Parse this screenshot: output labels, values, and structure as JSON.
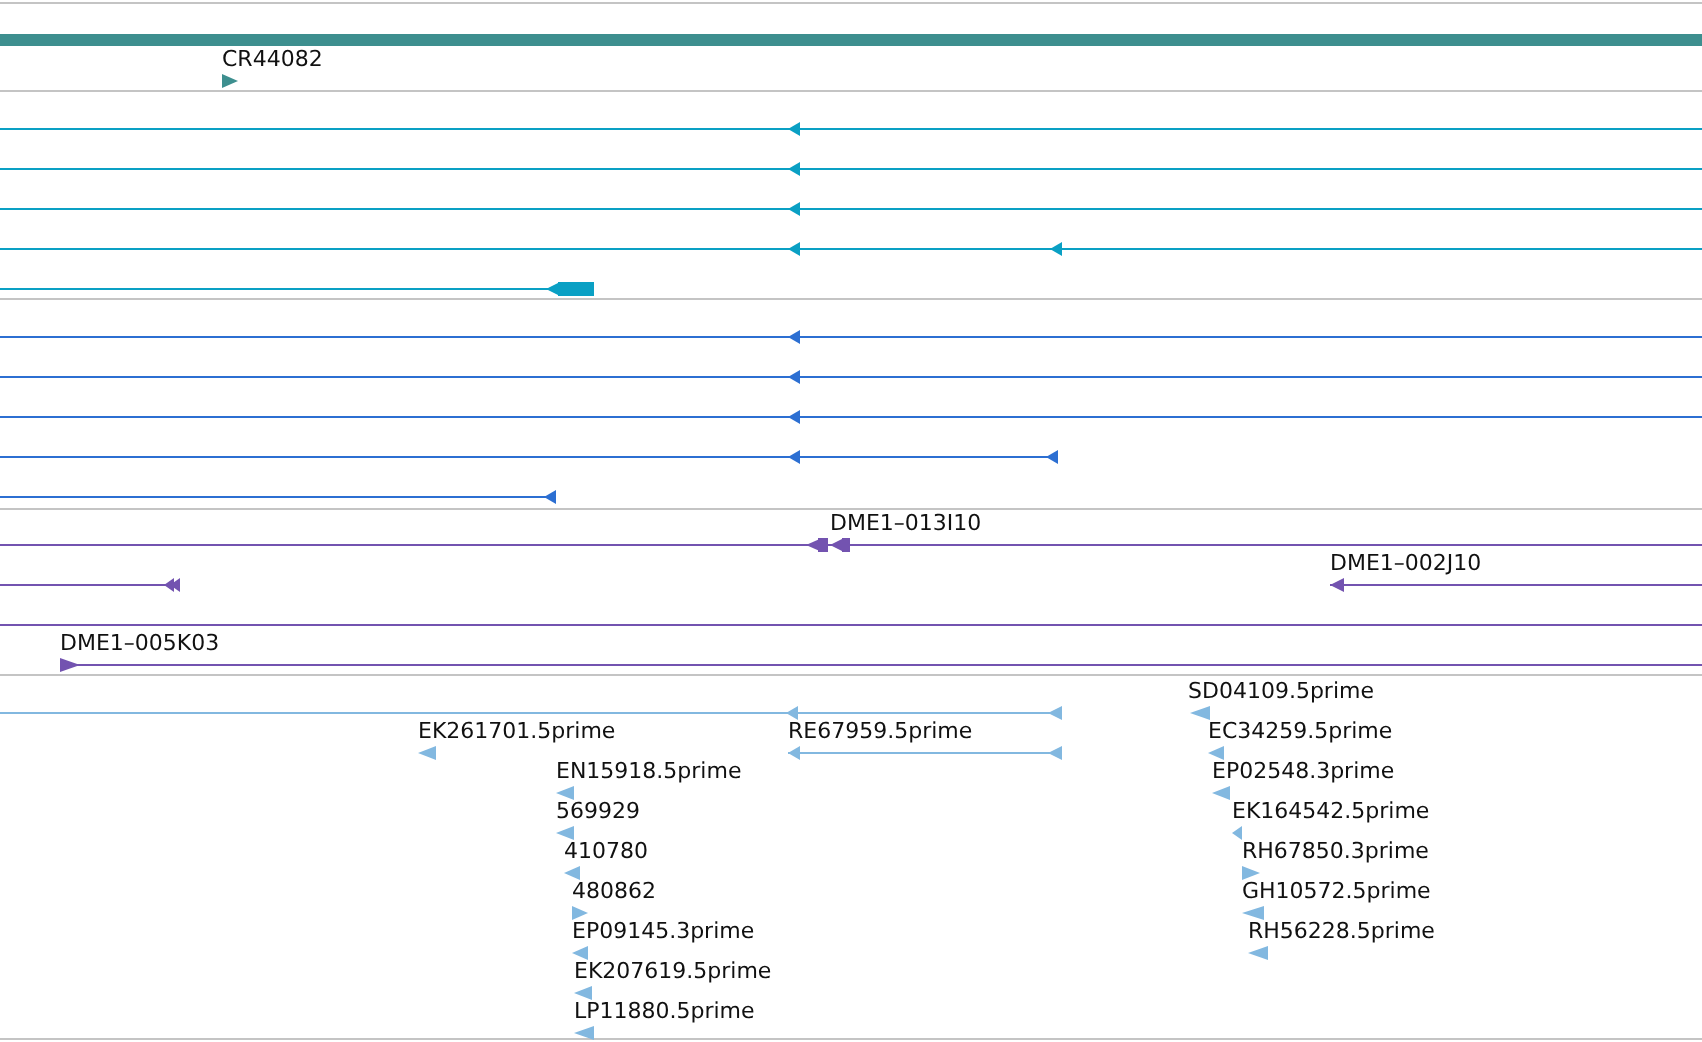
{
  "tracks": [
    {
      "color": "#3d8f8f",
      "features": [
        {
          "label": "CR44082",
          "kind": "forward"
        }
      ]
    },
    {
      "color": "#0aa0c4",
      "features": [
        {
          "kind": "reverse"
        },
        {
          "kind": "reverse"
        },
        {
          "kind": "reverse"
        },
        {
          "kind": "reverse"
        },
        {
          "kind": "reverse"
        }
      ]
    },
    {
      "color": "#2c6fd2",
      "features": [
        {
          "kind": "reverse"
        },
        {
          "kind": "reverse"
        },
        {
          "kind": "reverse"
        },
        {
          "kind": "reverse"
        },
        {
          "kind": "reverse"
        }
      ]
    },
    {
      "color": "#7353b0",
      "features": [
        {
          "label": "DME1–013I10",
          "kind": "reverse"
        },
        {
          "kind": "reverse"
        },
        {
          "label": "DME1–002J10",
          "kind": "reverse"
        },
        {
          "kind": "plain"
        },
        {
          "label": "DME1–005K03",
          "kind": "forward"
        }
      ]
    },
    {
      "color": "#82b8e0",
      "features": [
        {
          "kind": "reverse"
        },
        {
          "label": "SD04109.5prime",
          "kind": "reverse"
        },
        {
          "label": "EK261701.5prime",
          "kind": "reverse"
        },
        {
          "label": "RE67959.5prime",
          "kind": "reverse"
        },
        {
          "label": "EC34259.5prime",
          "kind": "reverse"
        },
        {
          "label": "EN15918.5prime",
          "kind": "reverse"
        },
        {
          "label": "EP02548.3prime",
          "kind": "reverse"
        },
        {
          "label": "569929",
          "kind": "reverse"
        },
        {
          "label": "EK164542.5prime",
          "kind": "reverse"
        },
        {
          "label": "410780",
          "kind": "reverse"
        },
        {
          "label": "RH67850.3prime",
          "kind": "forward"
        },
        {
          "label": "480862",
          "kind": "forward"
        },
        {
          "label": "GH10572.5prime",
          "kind": "reverse"
        },
        {
          "label": "EP09145.3prime",
          "kind": "reverse"
        },
        {
          "label": "RH56228.5prime",
          "kind": "reverse"
        },
        {
          "label": "EK207619.5prime",
          "kind": "reverse"
        },
        {
          "label": "LP11880.5prime",
          "kind": "reverse"
        }
      ]
    }
  ]
}
